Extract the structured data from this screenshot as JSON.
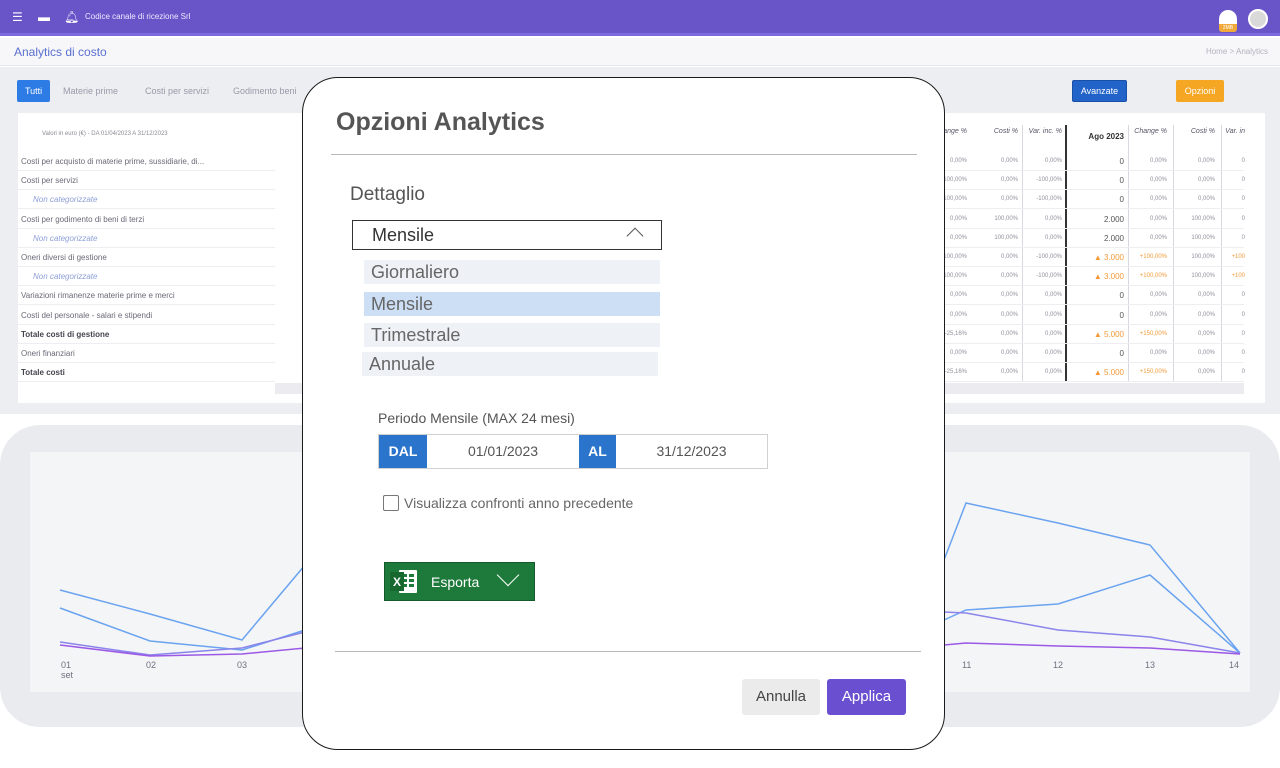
{
  "app": {
    "company": "Codice canale di ricezione Srl",
    "page_title": "Analytics di costo",
    "breadcrumb": [
      "Home",
      ">",
      "Analytics"
    ],
    "logo_text": "2MB"
  },
  "tabs": [
    "Tutti",
    "Materie prime",
    "Costi per servizi",
    "Godimento beni"
  ],
  "buttons": {
    "advanced": "Avanzate",
    "options": "Opzioni"
  },
  "table": {
    "values_note": "Valori in euro (€) - DA 01/04/2023 A 31/12/2023",
    "rows": [
      {
        "label": "Costi per acquisto di materie prime, sussidiarie, di...",
        "type": "normal"
      },
      {
        "label": "Costi per servizi",
        "type": "normal"
      },
      {
        "label": "Non categorizzate",
        "type": "sub"
      },
      {
        "label": "Costi per godimento di beni di terzi",
        "type": "normal"
      },
      {
        "label": "Non categorizzate",
        "type": "sub"
      },
      {
        "label": "Oneri diversi di gestione",
        "type": "normal"
      },
      {
        "label": "Non categorizzate",
        "type": "sub"
      },
      {
        "label": "Variazioni rimanenze materie prime e merci",
        "type": "normal"
      },
      {
        "label": "Costi del personale - salari e stipendi",
        "type": "normal"
      },
      {
        "label": "Totale costi di gestione",
        "type": "bold"
      },
      {
        "label": "Oneri finanziari",
        "type": "normal"
      },
      {
        "label": "Totale costi",
        "type": "bold"
      }
    ],
    "right_headers": [
      "Change %",
      "Costi %",
      "Var. inc. %",
      "Ago 2023",
      "Change %",
      "Costi %",
      "Var. in"
    ],
    "right_rows": [
      [
        "0,00%",
        "0,00%",
        "0,00%",
        "0",
        "0,00%",
        "0,00%",
        "0"
      ],
      [
        "-100,00%",
        "0,00%",
        "-100,00%",
        "0",
        "0,00%",
        "0,00%",
        "0"
      ],
      [
        "-100,00%",
        "0,00%",
        "-100,00%",
        "0",
        "0,00%",
        "0,00%",
        "0"
      ],
      [
        "0,00%",
        "100,00%",
        "0,00%",
        "2.000",
        "0,00%",
        "100,00%",
        "0"
      ],
      [
        "0,00%",
        "100,00%",
        "0,00%",
        "2.000",
        "0,00%",
        "100,00%",
        "0"
      ],
      [
        "-100,00%",
        "0,00%",
        "-100,00%",
        "▲ 3.000",
        "+100,00%",
        "100,00%",
        "+100"
      ],
      [
        "-100,00%",
        "0,00%",
        "-100,00%",
        "▲ 3.000",
        "+100,00%",
        "100,00%",
        "+100"
      ],
      [
        "0,00%",
        "0,00%",
        "0,00%",
        "0",
        "0,00%",
        "0,00%",
        "0"
      ],
      [
        "0,00%",
        "0,00%",
        "0,00%",
        "0",
        "0,00%",
        "0,00%",
        "0"
      ],
      [
        "-25,16%",
        "0,00%",
        "0,00%",
        "▲ 5.000",
        "+150,00%",
        "0,00%",
        "0"
      ],
      [
        "0,00%",
        "0,00%",
        "0,00%",
        "0",
        "0,00%",
        "0,00%",
        "0"
      ],
      [
        "-25,16%",
        "0,00%",
        "0,00%",
        "▲ 5.000",
        "+150,00%",
        "0,00%",
        "0"
      ]
    ]
  },
  "chart": {
    "x_labels": [
      "01",
      "02",
      "03",
      "11",
      "12",
      "13",
      "14"
    ],
    "x_sub": "set",
    "colors": [
      "#6aa3f0",
      "#7e7ae8",
      "#b48cf0"
    ]
  },
  "modal": {
    "title": "Opzioni Analytics",
    "detail_label": "Dettaglio",
    "selected": "Mensile",
    "options": [
      "Giornaliero",
      "Mensile",
      "Trimestrale",
      "Annuale"
    ],
    "period_label": "Periodo Mensile (MAX 24 mesi)",
    "from_tag": "DAL",
    "from_value": "01/01/2023",
    "to_tag": "AL",
    "to_value": "31/12/2023",
    "compare_label": "Visualizza confronti anno precedente",
    "export_label": "Esporta",
    "cancel_label": "Annulla",
    "apply_label": "Applica"
  }
}
